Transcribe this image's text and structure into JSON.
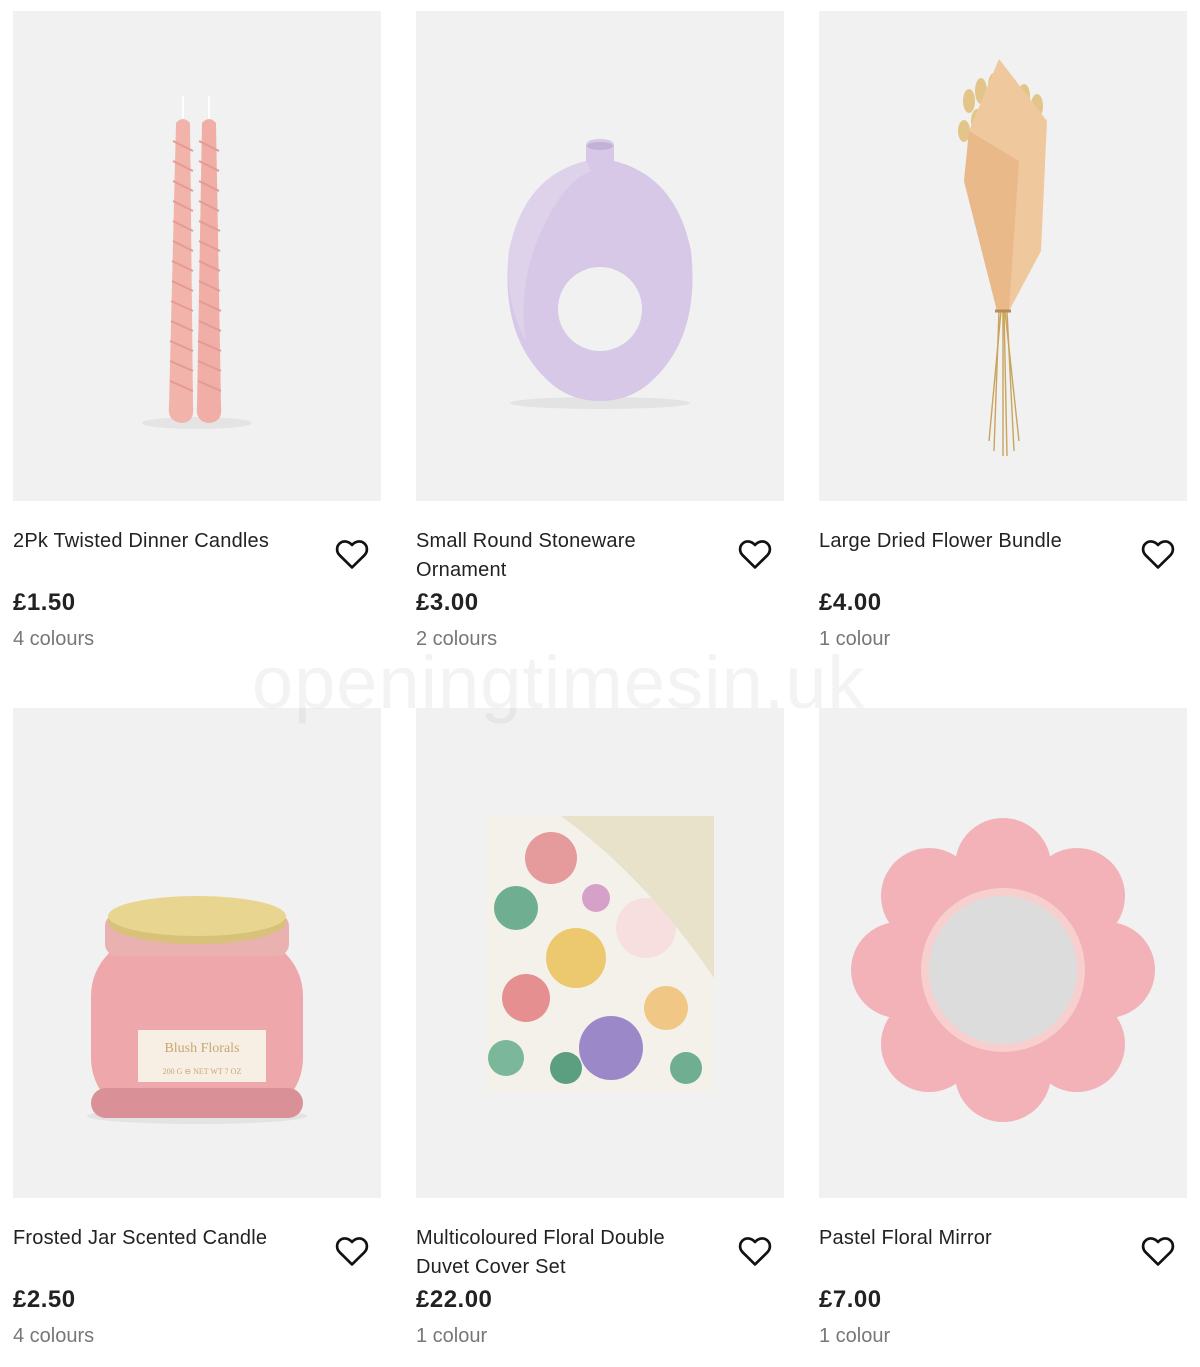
{
  "products": [
    {
      "name": "2Pk Twisted Dinner Candles",
      "price": "£1.50",
      "colours": "4 colours",
      "image": "twisted-candles",
      "wishlist_icon": "heart-outline-icon"
    },
    {
      "name": "Small Round Stoneware Ornament",
      "price": "£3.00",
      "colours": "2 colours",
      "image": "round-vase",
      "wishlist_icon": "heart-outline-icon"
    },
    {
      "name": "Large Dried Flower Bundle",
      "price": "£4.00",
      "colours": "1 colour",
      "image": "dried-flower-bundle",
      "wishlist_icon": "heart-outline-icon"
    },
    {
      "name": "Frosted Jar Scented Candle",
      "price": "£2.50",
      "colours": "4 colours",
      "image": "jar-candle",
      "wishlist_icon": "heart-outline-icon",
      "jar_label": "Blush Florals",
      "jar_subtext": "200 G ⊖ NET WT 7 OZ"
    },
    {
      "name": "Multicoloured Floral Double Duvet Cover Set",
      "price": "£22.00",
      "colours": "1 colour",
      "image": "floral-duvet",
      "wishlist_icon": "heart-outline-icon"
    },
    {
      "name": "Pastel Floral Mirror",
      "price": "£7.00",
      "colours": "1 colour",
      "image": "flower-mirror",
      "wishlist_icon": "heart-outline-icon"
    }
  ],
  "watermark": "openingtimesin.uk",
  "colors": {
    "tile_bg": "#f1f1f1",
    "text": "#222222",
    "muted": "#777777",
    "candle_pink": "#f3b5ae",
    "vase_lilac": "#d5c6e6",
    "mirror_pink": "#f3b3b9"
  }
}
